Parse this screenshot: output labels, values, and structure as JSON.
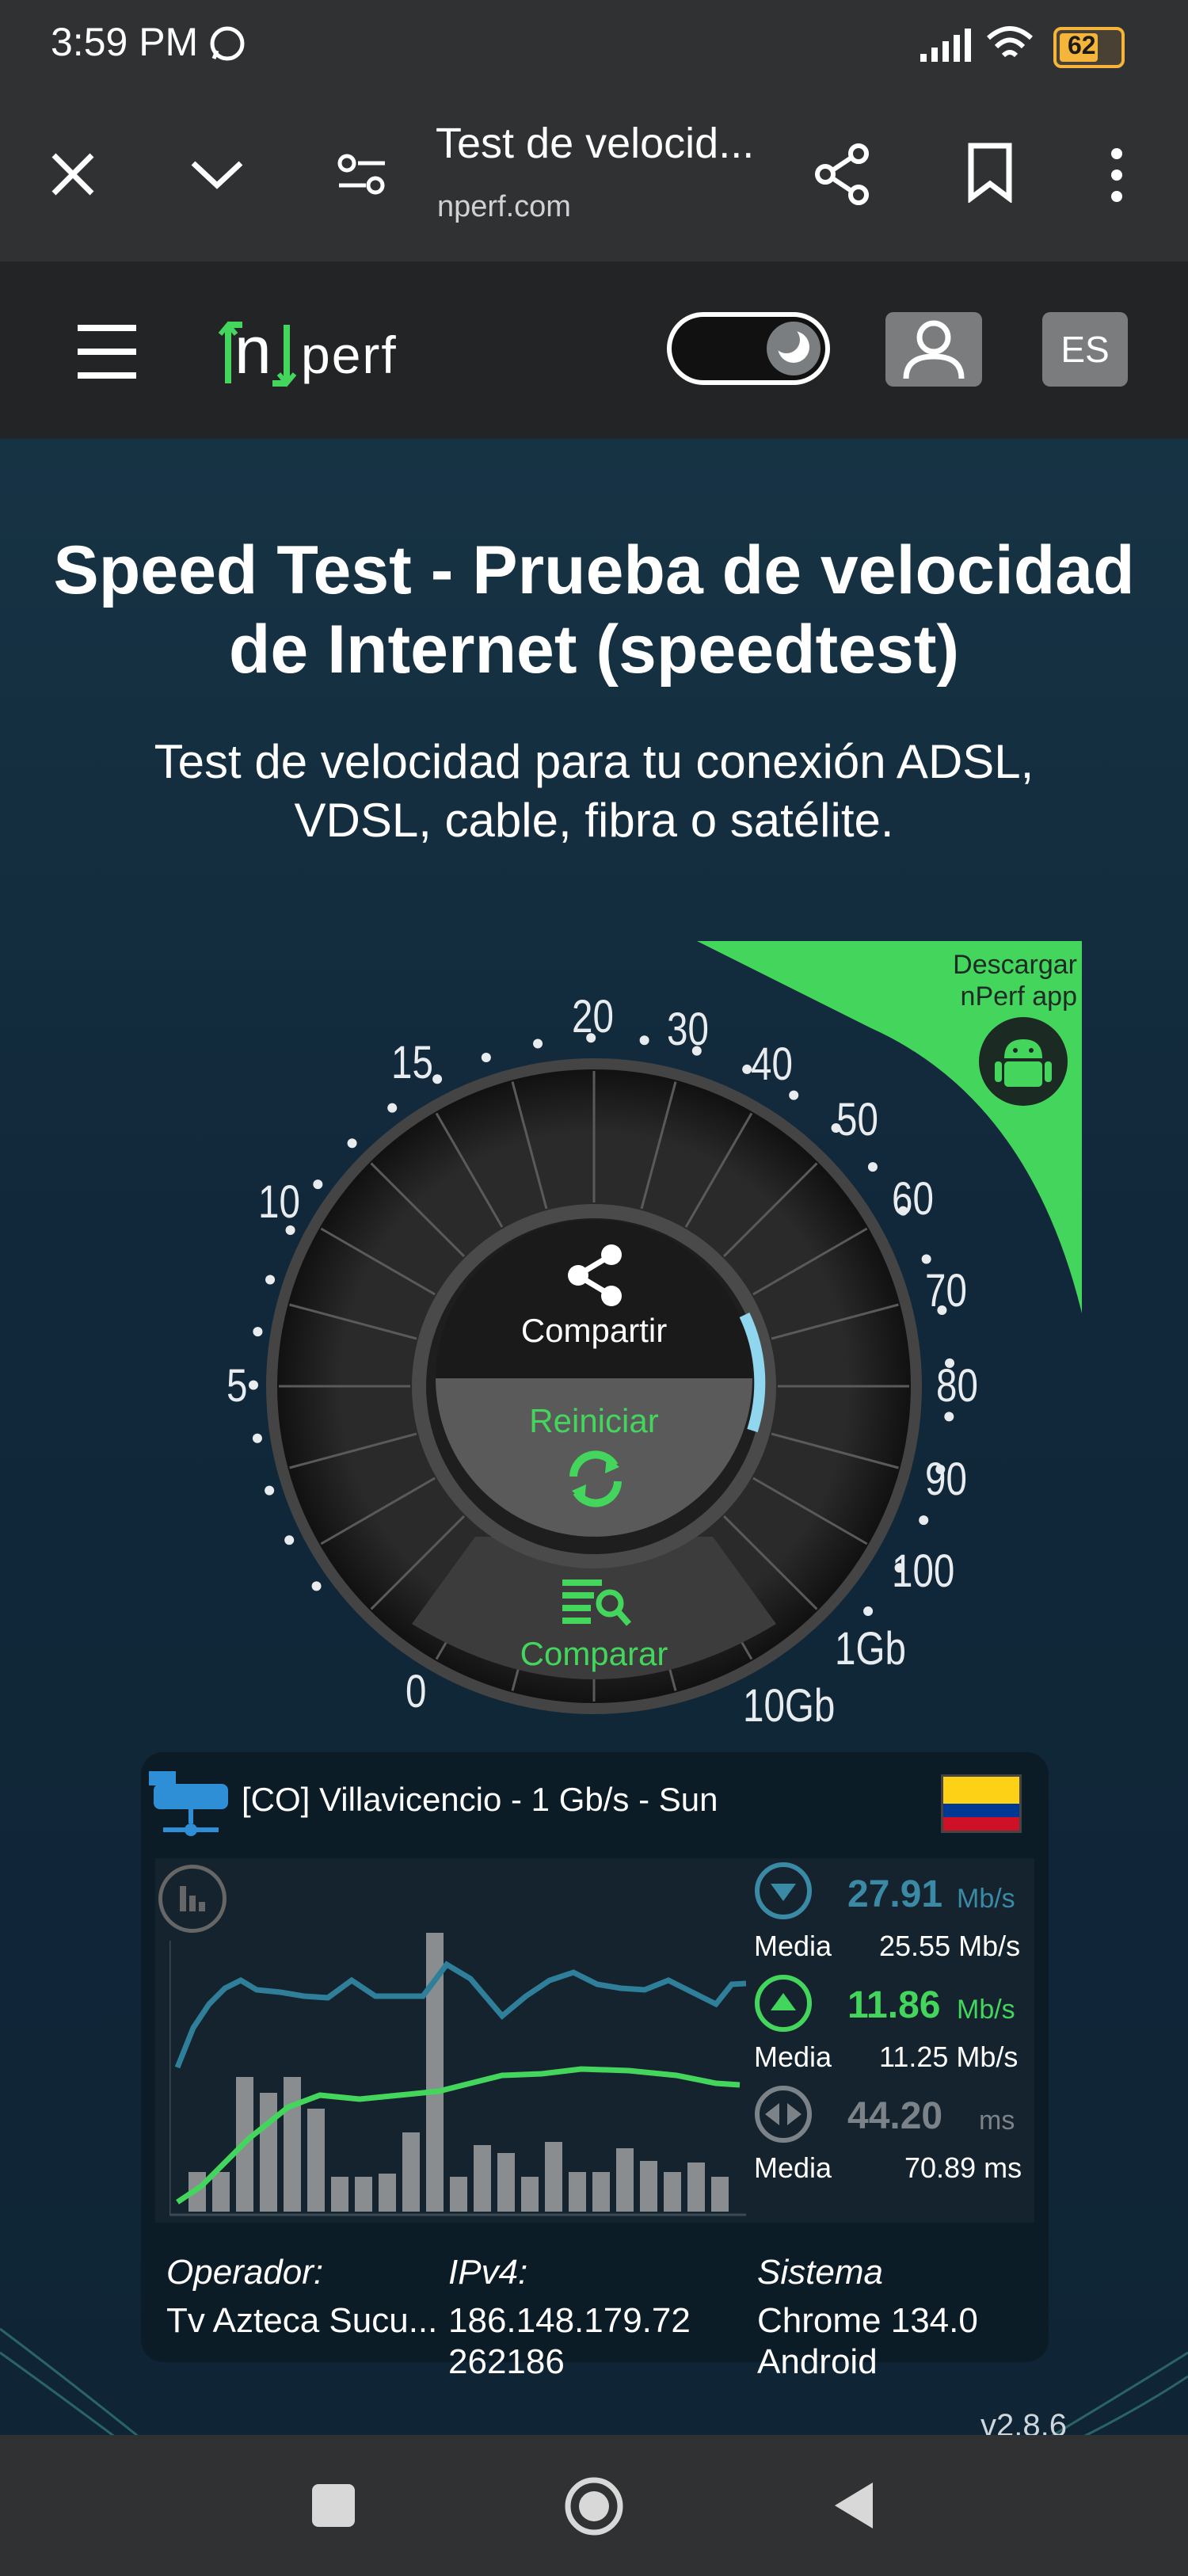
{
  "status": {
    "time": "3:59 PM",
    "battery": "62"
  },
  "browser": {
    "tab_title": "Test de velocid...",
    "url": "nperf.com"
  },
  "site": {
    "logo_text_n": "n",
    "logo_text_rest": "perf",
    "lang": "ES"
  },
  "hero": {
    "title_line1": "Speed Test - Prueba de velocidad",
    "title_line2": "de Internet (speedtest)",
    "subtitle_line1": "Test de velocidad para tu conexión ADSL,",
    "subtitle_line2": "VDSL, cable, fibra o satélite."
  },
  "app_promo": {
    "line1": "Descargar",
    "line2": "nPerf app"
  },
  "gauge": {
    "scale": [
      "0",
      "5",
      "10",
      "15",
      "20",
      "30",
      "40",
      "50",
      "60",
      "70",
      "80",
      "90",
      "100",
      "1Gb",
      "10Gb"
    ],
    "share_label": "Compartir",
    "restart_label": "Reiniciar",
    "compare_label": "Comparar"
  },
  "result": {
    "server": "[CO] Villavicencio - 1 Gb/s - Sun",
    "download": {
      "value": "27.91",
      "unit": "Mb/s",
      "avg_label": "Media",
      "avg": "25.55 Mb/s"
    },
    "upload": {
      "value": "11.86",
      "unit": "Mb/s",
      "avg_label": "Media",
      "avg": "11.25 Mb/s"
    },
    "latency": {
      "value": "44.20",
      "unit": "ms",
      "avg_label": "Media",
      "avg": "70.89 ms"
    },
    "operator_label": "Operador:",
    "operator": "Tv Azteca Sucu...",
    "ipv4_label": "IPv4:",
    "ipv4_line1": "186.148.179.72",
    "ipv4_line2": "262186",
    "system_label": "Sistema",
    "system_line1": "Chrome 134.0",
    "system_line2": "Android"
  },
  "version": "v2.8.6",
  "colors": {
    "green": "#44d65c",
    "blue": "#3a8aa6",
    "panel": "#0c1c27"
  }
}
